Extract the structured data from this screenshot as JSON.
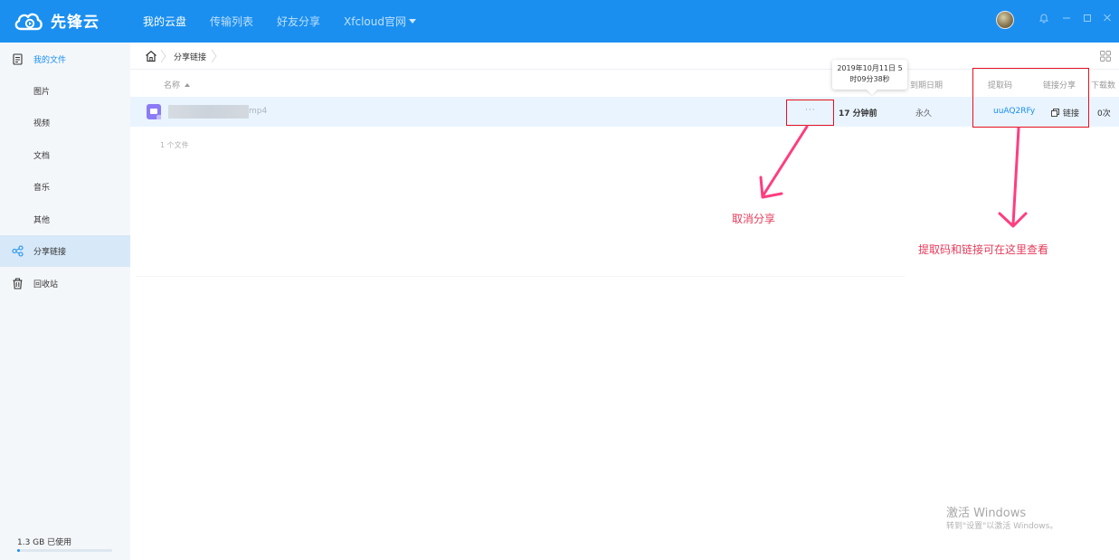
{
  "app": {
    "name": "先锋云"
  },
  "nav": {
    "items": [
      {
        "label": "我的云盘",
        "active": true
      },
      {
        "label": "传输列表",
        "active": false
      },
      {
        "label": "好友分享",
        "active": false
      },
      {
        "label": "Xfcloud官网",
        "active": false,
        "dropdown": true
      }
    ]
  },
  "window_controls": [
    "bell-icon",
    "minimize-icon",
    "maximize-icon",
    "close-icon"
  ],
  "sidebar": {
    "items": [
      {
        "label": "我的文件",
        "icon": "document-icon",
        "type": "main"
      },
      {
        "label": "图片",
        "type": "sub"
      },
      {
        "label": "视频",
        "type": "sub"
      },
      {
        "label": "文档",
        "type": "sub"
      },
      {
        "label": "音乐",
        "type": "sub"
      },
      {
        "label": "其他",
        "type": "sub"
      },
      {
        "label": "分享链接",
        "icon": "share-icon",
        "type": "main",
        "selected": true
      },
      {
        "label": "回收站",
        "icon": "trash-icon",
        "type": "main"
      }
    ],
    "quota": {
      "label": "1.3 GB 已使用",
      "used_fraction": 0.03
    }
  },
  "breadcrumb": {
    "current": "分享链接"
  },
  "table": {
    "columns": {
      "name": "名称",
      "expire": "到期日期",
      "code": "提取码",
      "link": "链接分享",
      "downloads": "下载数"
    },
    "rows": [
      {
        "ext": "mp4",
        "more": "···",
        "time": "17 分钟前",
        "expire": "永久",
        "code": "uuAQ2RFy",
        "link": "链接",
        "downloads": "0次"
      }
    ],
    "file_count": "1 个文件"
  },
  "tooltip": {
    "line1": "2019年10月11日 5",
    "line2": "时09分38秒"
  },
  "annotations": {
    "cancel_share": "取消分享",
    "code_link_hint": "提取码和链接可在这里查看",
    "color": "#e63b5a",
    "box_color": "#e8101f"
  },
  "watermark": {
    "title": "激活 Windows",
    "subtitle": "转到\"设置\"以激活 Windows。"
  },
  "colors": {
    "brand": "#1a8ff0",
    "row_highlight": "#e9f4ff",
    "sidebar_bg": "#f4f7fa",
    "file_icon": "#8b7cf6"
  }
}
